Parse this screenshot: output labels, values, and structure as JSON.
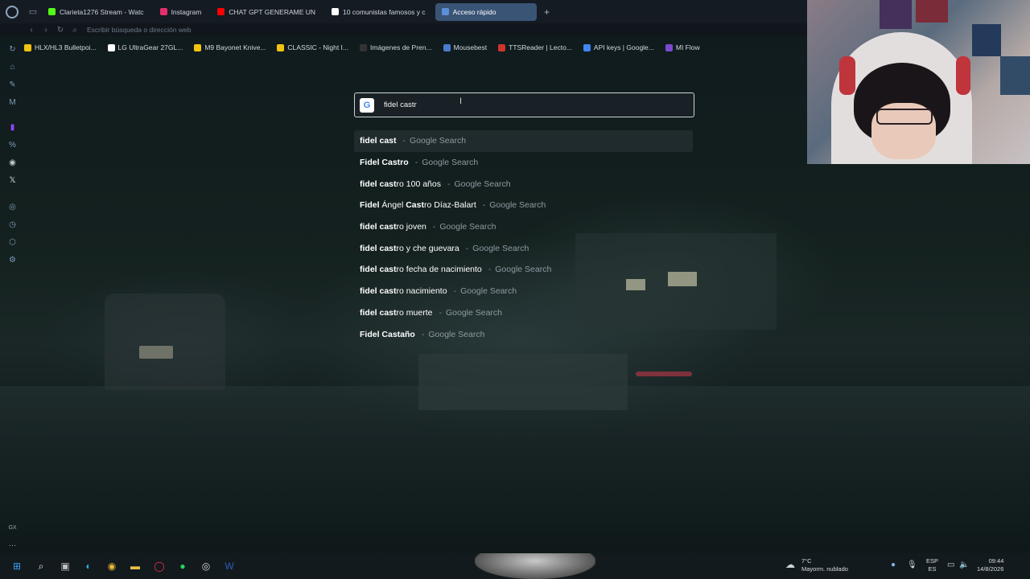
{
  "tabs": [
    {
      "label": "Clarieta1276 Stream - Watc",
      "color": "#53fc18"
    },
    {
      "label": "Instagram",
      "color": "#e1306c"
    },
    {
      "label": "CHAT GPT GENERAME UN",
      "color": "#ff0000"
    },
    {
      "label": "10 comunistas famosos y c",
      "color": "#ffffff"
    },
    {
      "label": "Acceso rápido",
      "color": "#5b8fd9",
      "active": true
    }
  ],
  "address_bar": {
    "placeholder": "Escribir búsqueda o dirección web"
  },
  "bookmarks": [
    {
      "label": "HLX/HL3 Bulletpoi...",
      "color": "#f1c40f"
    },
    {
      "label": "LG UltraGear 27GL...",
      "color": "#ffffff"
    },
    {
      "label": "M9 Bayonet Knive...",
      "color": "#f1c40f"
    },
    {
      "label": "CLASSIC - Night I...",
      "color": "#f1c40f"
    },
    {
      "label": "Imágenes de Pren...",
      "color": "#333333"
    },
    {
      "label": "Mousebest",
      "color": "#4a7bd0"
    },
    {
      "label": "TTSReader | Lecto...",
      "color": "#d0342c"
    },
    {
      "label": "API keys | Google...",
      "color": "#4285f4"
    },
    {
      "label": "MI Flow",
      "color": "#7b4ad0"
    }
  ],
  "sidebar": {
    "icons": [
      "history-icon",
      "shop-icon",
      "edit-icon",
      "m-icon",
      "twitch-icon",
      "percent-icon",
      "discord-icon",
      "x-icon",
      "target-icon",
      "clock-icon",
      "cube-icon",
      "settings-icon"
    ],
    "bottom_label": "GX"
  },
  "search": {
    "engine": "G",
    "value": "fidel castr"
  },
  "suggestions": [
    {
      "bold": "fidel cast",
      "rest": "",
      "source": "Google Search"
    },
    {
      "bold": "Fidel Castro",
      "rest": "",
      "source": "Google Search"
    },
    {
      "bold": "fidel cast",
      "rest": "ro 100 años",
      "source": "Google Search"
    },
    {
      "bold": "Fidel",
      "rest": " Ángel ",
      "bold2": "Cast",
      "rest2": "ro Díaz-Balart",
      "source": "Google Search"
    },
    {
      "bold": "fidel cast",
      "rest": "ro joven",
      "source": "Google Search"
    },
    {
      "bold": "fidel cast",
      "rest": "ro y che guevara",
      "source": "Google Search"
    },
    {
      "bold": "fidel cast",
      "rest": "ro fecha de nacimiento",
      "source": "Google Search"
    },
    {
      "bold": "fidel cast",
      "rest": "ro nacimiento",
      "source": "Google Search"
    },
    {
      "bold": "fidel cast",
      "rest": "ro muerte",
      "source": "Google Search"
    },
    {
      "bold": "Fidel Castaño",
      "rest": "",
      "source": "Google Search"
    }
  ],
  "taskbar": {
    "weather_temp": "7°C",
    "weather_desc": "Mayorm. nublado",
    "lang_top": "ESP",
    "lang_bottom": "ES",
    "time": "09:44",
    "date": "14/8/2026"
  }
}
